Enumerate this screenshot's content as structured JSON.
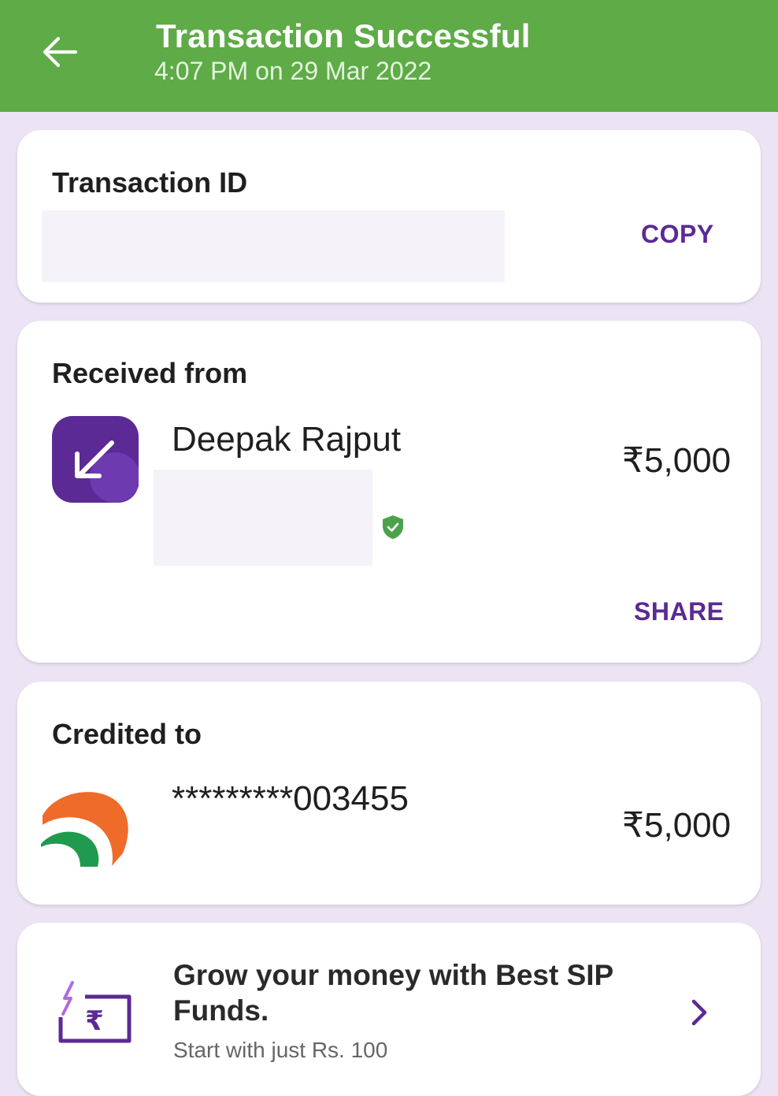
{
  "header": {
    "title": "Transaction Successful",
    "subtitle": "4:07 PM on 29 Mar 2022",
    "background_color": "#5EAB47"
  },
  "transaction": {
    "title": "Transaction ID",
    "copy_label": "COPY"
  },
  "received": {
    "title": "Received from",
    "name": "Deepak Rajput",
    "amount": "₹5,000",
    "share_label": "SHARE",
    "icon": "arrow-down-left-icon",
    "verified_icon": "verified-shield-icon"
  },
  "credited": {
    "title": "Credited to",
    "account": "*********003455",
    "amount": "₹5,000",
    "icon": "bank-logo-icon"
  },
  "promo": {
    "title": "Grow your money with Best SIP Funds.",
    "subtitle": "Start with just Rs. 100",
    "icon": "sip-rupee-icon",
    "chevron_icon": "chevron-right-icon"
  },
  "colors": {
    "accent": "#5B2A94",
    "success": "#5EAB47",
    "background": "#ECE4F4"
  }
}
